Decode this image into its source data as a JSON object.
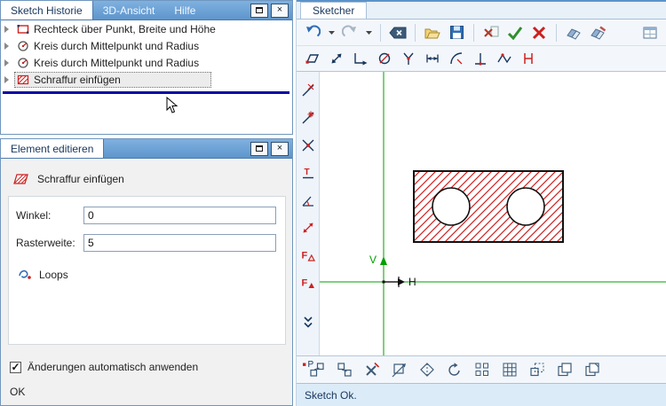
{
  "history_window": {
    "tabs": [
      {
        "label": "Sketch Historie",
        "active": true
      },
      {
        "label": "3D-Ansicht",
        "active": false
      },
      {
        "label": "Hilfe",
        "active": false
      }
    ],
    "items": [
      {
        "label": "Rechteck über Punkt, Breite und Höhe",
        "icon": "rectangle-icon",
        "selected": false
      },
      {
        "label": "Kreis durch Mittelpunkt und Radius",
        "icon": "circle-icon",
        "selected": false
      },
      {
        "label": "Kreis durch Mittelpunkt und Radius",
        "icon": "circle-icon",
        "selected": false
      },
      {
        "label": "Schraffur einfügen",
        "icon": "hatch-icon",
        "selected": true
      }
    ]
  },
  "editor_window": {
    "title": "Element editieren",
    "element_icon": "hatch-icon",
    "element_label": "Schraffur einfügen",
    "fields": [
      {
        "label": "Winkel:",
        "value": "0"
      },
      {
        "label": "Rasterweite:",
        "value": "5"
      }
    ],
    "loops_label": "Loops",
    "apply_checkbox_label": "Änderungen automatisch anwenden",
    "apply_checkbox_checked": true,
    "ok_label": "OK"
  },
  "sketcher_panel": {
    "tab_label": "Sketcher",
    "status_text": "Sketch Ok.",
    "axes": {
      "vertical_label": "V",
      "horizontal_label": "H"
    },
    "toolbar_main_icons": [
      "undo",
      "undo-dropdown",
      "redo",
      "redo-dropdown",
      "backspace-delete",
      "open-sketch",
      "save-sketch",
      "delete-element",
      "accept-sketch",
      "cancel-sketch",
      "eraser",
      "eraser-pencil",
      "window-grid"
    ],
    "toolbar_draw_icons": [
      "move-vertex",
      "stretch-arrows",
      "corner-arrow",
      "circle-modify",
      "split-y",
      "dimension-horizontal",
      "tangent-arc",
      "perpendicular",
      "polyline-join",
      "dimension-red"
    ],
    "toolbar_left_icons": [
      "snap-point",
      "snap-star",
      "snap-intersection",
      "tangent-constraint",
      "angle-constraint",
      "distance-constraint",
      "fix-constraint-a",
      "fix-constraint-b",
      "collapse-chevron",
      "point-label"
    ],
    "toolbar_bottom_icons": [
      "reorder-a",
      "reorder-b",
      "delete-x",
      "move-diagonal",
      "mirror-diamond",
      "rotate-arc",
      "grid-pattern-a",
      "grid-pattern-b",
      "scale-rect",
      "copy-stack",
      "paste-stack"
    ]
  },
  "colors": {
    "hatch_red": "#cc2222",
    "axis_green": "#00a000",
    "insert_line_blue": "#0008a8",
    "header_blue": "#5e95cb",
    "accent_navy": "#17365d"
  }
}
